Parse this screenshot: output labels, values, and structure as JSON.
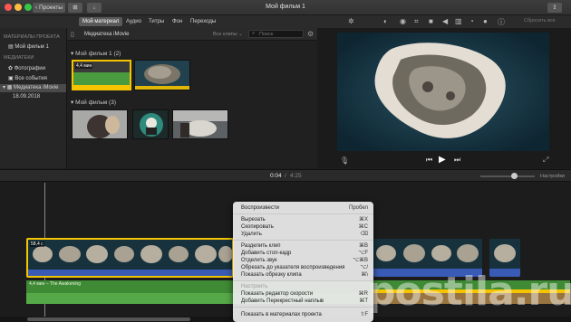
{
  "window": {
    "title": "Мой фильм 1",
    "back_button": "Проекты",
    "filter_label": "⊞",
    "import_label": "↓"
  },
  "tabs": [
    {
      "label": "Мой материал",
      "active": true
    },
    {
      "label": "Аудио",
      "active": false
    },
    {
      "label": "Титры",
      "active": false
    },
    {
      "label": "Фон",
      "active": false
    },
    {
      "label": "Переходы",
      "active": false
    }
  ],
  "sidebar": {
    "projects_header": "МАТЕРИАЛЫ ПРОЕКТА",
    "project_item": "Мой фильм 1",
    "library_header": "МЕДИАТЕКИ",
    "photos": "Фотографии",
    "all_events": "Все события",
    "library": "Медиатека iMovie",
    "date_item": "18.09.2018"
  },
  "browser": {
    "title": "Медиатека iMovie",
    "filter": "Все клипы ⌄",
    "search_placeholder": "Поиск",
    "group1": "Мой фильм 1  (2)",
    "group2": "Мой фильм  (3)",
    "clip_duration": "4,4 мин"
  },
  "viewer": {
    "reset_all": "Сбросить все"
  },
  "timeline": {
    "current_time": "0:04",
    "separator": "/",
    "total_time": "4:25",
    "settings": "Настройки",
    "clip_label": "58,4 с",
    "audio_label": "4,4 мин – The Awakening"
  },
  "context_menu": {
    "items": [
      {
        "label": "Воспроизвести",
        "key": "Пробел",
        "enabled": true
      },
      {
        "label": "Вырезать",
        "key": "⌘X",
        "enabled": true
      },
      {
        "label": "Скопировать",
        "key": "⌘C",
        "enabled": true
      },
      {
        "label": "Удалить",
        "key": "⌫",
        "enabled": true
      },
      {
        "label": "Разделить клип",
        "key": "⌘B",
        "enabled": true
      },
      {
        "label": "Добавить стоп-кадр",
        "key": "⌥F",
        "enabled": true
      },
      {
        "label": "Отделить звук",
        "key": "⌥⌘B",
        "enabled": true
      },
      {
        "label": "Обрезать до указателя воспроизведения",
        "key": "⌥/",
        "enabled": true
      },
      {
        "label": "Показать обрезку клипа",
        "key": "⌘\\",
        "enabled": true
      },
      {
        "label": "Настроить",
        "key": "",
        "enabled": false
      },
      {
        "label": "Показать редактор скорости",
        "key": "⌘R",
        "enabled": true
      },
      {
        "label": "Добавить Перекрестный наплыв",
        "key": "⌘T",
        "enabled": true
      },
      {
        "label": "Показать в материалах проекта",
        "key": "⇧F",
        "enabled": true
      }
    ]
  },
  "watermark": "postila.ru",
  "colors": {
    "accent": "#f5c400",
    "audio_green": "#3f8a34",
    "clip_blue": "#3a5bb5",
    "window_bg": "#1e1e1e"
  }
}
